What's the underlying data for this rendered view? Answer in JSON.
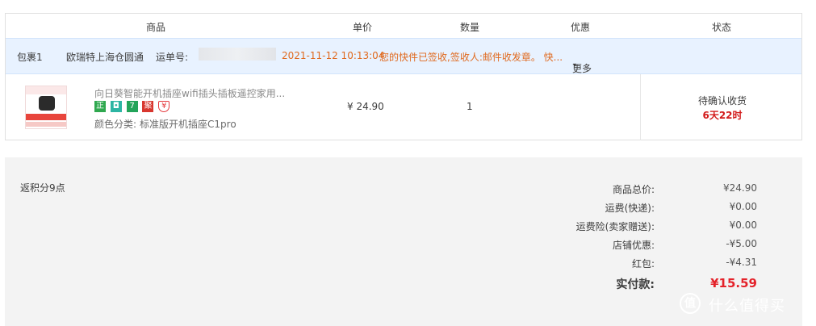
{
  "table_header": {
    "product": "商品",
    "unit_price": "单价",
    "quantity": "数量",
    "discount": "优惠",
    "status": "状态"
  },
  "package": {
    "label": "包裹1",
    "courier": "欧瑞特上海仓圆通",
    "tracking_label": "运单号:",
    "datetime": "2021-11-12 10:13:04",
    "status_message": "您的快件已签收,签收人:邮件收发章。 快...",
    "more": "更多"
  },
  "item": {
    "title": "向日葵智能开机插座wifi插头插板遥控家用...",
    "badges": [
      {
        "icon": "zheng-badge-icon",
        "text": "正",
        "color": "#2fa84f"
      },
      {
        "icon": "shield-badge-icon",
        "text": "◘",
        "color": "#2db5a3"
      },
      {
        "icon": "seven-day-badge-icon",
        "text": "7",
        "color": "#23a45a"
      },
      {
        "icon": "ju-badge-icon",
        "text": "聚",
        "color": "#d8372f"
      },
      {
        "icon": "yen-badge-icon",
        "text": "¥",
        "color": "#e4393c"
      }
    ],
    "spec_label": "颜色分类:",
    "spec_value": "标准版开机插座C1pro",
    "price": "¥ 24.90",
    "quantity": "1",
    "status_line1": "待确认收货",
    "status_line2": "6天22时"
  },
  "summary": {
    "points": "返积分9点",
    "rows": [
      {
        "label": "商品总价:",
        "value": "¥24.90"
      },
      {
        "label": "运费(快递):",
        "value": "¥0.00"
      },
      {
        "label": "运费险(卖家赠送):",
        "value": "¥0.00"
      },
      {
        "label": "店铺优惠:",
        "value": "-¥5.00"
      },
      {
        "label": "红包:",
        "value": "-¥4.31"
      }
    ],
    "total_label": "实付款:",
    "total_value": "¥15.59"
  },
  "watermark": {
    "logo": "值",
    "text": "什么值得买"
  },
  "colors": {
    "package_bar": "#e8f2ff",
    "status_orange": "#e06a1f",
    "total_red": "#e4222a",
    "summary_bg": "#f3f3f3"
  }
}
